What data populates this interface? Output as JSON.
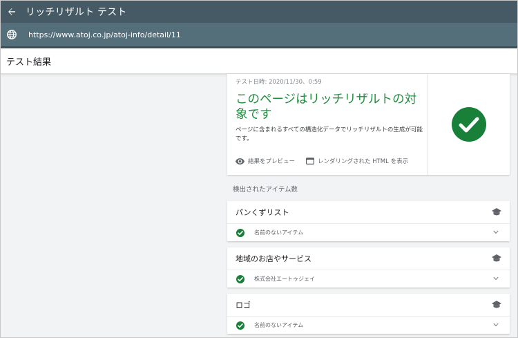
{
  "appbar": {
    "title": "リッチリザルト テスト"
  },
  "urlbar": {
    "url": "https://www.atoj.co.jp/atoj-info/detail/11"
  },
  "section": {
    "title": "テスト結果"
  },
  "summary": {
    "date": "テスト日時: 2020/11/30、0:59",
    "headline": "このページはリッチリザルトの対象です",
    "description": "ページに含まれるすべての構造化データでリッチリザルトの生成が可能です。",
    "preview_label": "結果をプレビュー",
    "rendered_html_label": "レンダリングされた HTML を表示"
  },
  "detected": {
    "label": "検出されたアイテム数",
    "items": [
      {
        "type": "パンくずリスト",
        "item": "名前のないアイテム"
      },
      {
        "type": "地域のお店やサービス",
        "item": "株式会社エートゥジェイ"
      },
      {
        "type": "ロゴ",
        "item": "名前のないアイテム"
      }
    ]
  },
  "colors": {
    "appbar": "#455a64",
    "urlbar": "#546e7a",
    "success": "#1e8e3e",
    "check": "#188038"
  }
}
